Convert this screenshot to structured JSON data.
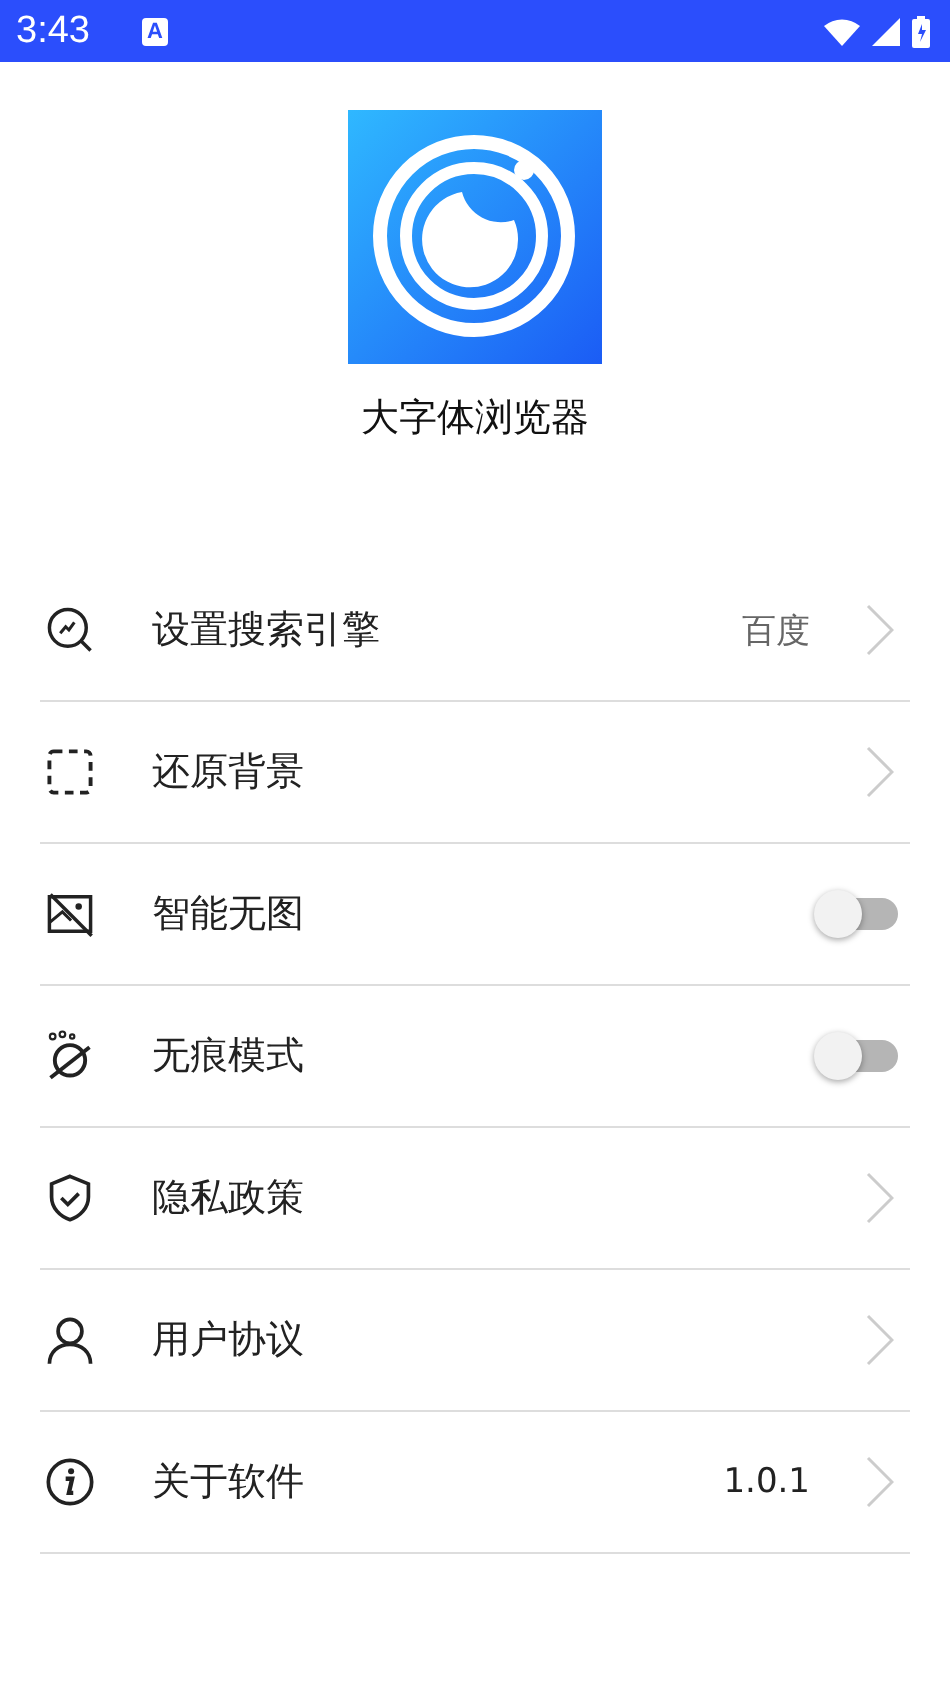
{
  "status_bar": {
    "time": "3:43",
    "notification_glyph": "A"
  },
  "app": {
    "name": "大字体浏览器"
  },
  "settings": [
    {
      "kind": "link",
      "label": "设置搜索引擎",
      "value": "百度"
    },
    {
      "kind": "link",
      "label": "还原背景"
    },
    {
      "kind": "toggle",
      "label": "智能无图",
      "on": false
    },
    {
      "kind": "toggle",
      "label": "无痕模式",
      "on": false
    },
    {
      "kind": "link",
      "label": "隐私政策"
    },
    {
      "kind": "link",
      "label": "用户协议"
    },
    {
      "kind": "link",
      "label": "关于软件",
      "value": "1.0.1"
    }
  ]
}
